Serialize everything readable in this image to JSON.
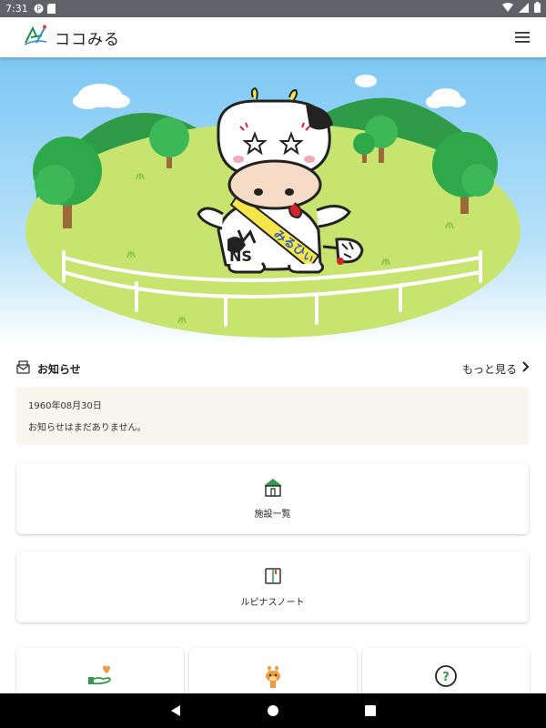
{
  "status_bar": {
    "time": "7:31"
  },
  "app_bar": {
    "title": "ココみる",
    "logo_icon": "ns-logo-icon",
    "menu_icon": "hamburger-menu-icon"
  },
  "hero": {
    "sash_text": "みるひぃ",
    "badge_text": "NS"
  },
  "news": {
    "title": "お知らせ",
    "more_label": "もっと見る",
    "date": "1960年08月30日",
    "message": "お知らせはまだありません。"
  },
  "cards": [
    {
      "label": "施設一覧",
      "icon": "facility-house-icon"
    },
    {
      "label": "ルピナスノート",
      "icon": "notebook-icon"
    }
  ],
  "small_cards": [
    {
      "icon": "heart-hand-icon"
    },
    {
      "icon": "giraffe-icon"
    },
    {
      "icon": "question-icon"
    }
  ],
  "colors": {
    "status_bar": "#5f6368",
    "sky": "#8fd0f6",
    "grass": "#c7e46e",
    "tree": "#2fa84a",
    "news_bg": "#f8f5ef",
    "accent_green": "#2f9a48",
    "accent_orange": "#f29a3a"
  }
}
